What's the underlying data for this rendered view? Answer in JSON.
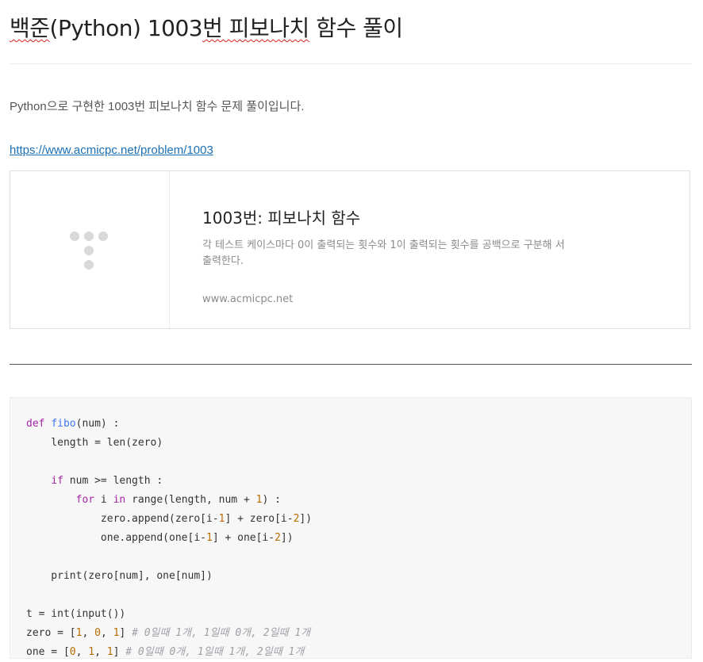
{
  "post": {
    "title_prefix": "백준",
    "title_middle": "(Python) 1003",
    "title_squiggle": "번 피보나치",
    "title_suffix": " 함수 풀이",
    "intro": "Python으로 구현한 1003번 피보나치 함수 문제 풀이입니다.",
    "link_text": "https://www.acmicpc.net/problem/1003"
  },
  "link_card": {
    "title": "1003번: 피보나치 함수",
    "description": "각 테스트 케이스마다 0이 출력되는 횟수와 1이 출력되는 횟수를 공백으로 구분해 서 출력한다.",
    "domain": "www.acmicpc.net"
  },
  "code": {
    "lines": [
      [
        {
          "t": "def",
          "c": "kw"
        },
        {
          "t": " "
        },
        {
          "t": "fibo",
          "c": "fn"
        },
        {
          "t": "(num) :"
        }
      ],
      [
        {
          "t": "    length = len(zero)"
        }
      ],
      [
        {
          "t": ""
        }
      ],
      [
        {
          "t": "    "
        },
        {
          "t": "if",
          "c": "kw"
        },
        {
          "t": " num >= length :"
        }
      ],
      [
        {
          "t": "        "
        },
        {
          "t": "for",
          "c": "kw"
        },
        {
          "t": " i "
        },
        {
          "t": "in",
          "c": "kw"
        },
        {
          "t": " range(length, num + "
        },
        {
          "t": "1",
          "c": "num"
        },
        {
          "t": ") :"
        }
      ],
      [
        {
          "t": "            zero.append(zero[i-"
        },
        {
          "t": "1",
          "c": "num"
        },
        {
          "t": "] + zero[i-"
        },
        {
          "t": "2",
          "c": "num"
        },
        {
          "t": "])"
        }
      ],
      [
        {
          "t": "            one.append(one[i-"
        },
        {
          "t": "1",
          "c": "num"
        },
        {
          "t": "] + one[i-"
        },
        {
          "t": "2",
          "c": "num"
        },
        {
          "t": "])"
        }
      ],
      [
        {
          "t": ""
        }
      ],
      [
        {
          "t": "    print(zero[num], one[num])"
        }
      ],
      [
        {
          "t": ""
        }
      ],
      [
        {
          "t": "t = int(input())"
        }
      ],
      [
        {
          "t": "zero = ["
        },
        {
          "t": "1",
          "c": "num"
        },
        {
          "t": ", "
        },
        {
          "t": "0",
          "c": "num"
        },
        {
          "t": ", "
        },
        {
          "t": "1",
          "c": "num"
        },
        {
          "t": "] "
        },
        {
          "t": "# 0일때 1개, 1일때 0개, 2일때 1개",
          "c": "cm"
        }
      ],
      [
        {
          "t": "one = ["
        },
        {
          "t": "0",
          "c": "num"
        },
        {
          "t": ", "
        },
        {
          "t": "1",
          "c": "num"
        },
        {
          "t": ", "
        },
        {
          "t": "1",
          "c": "num"
        },
        {
          "t": "] "
        },
        {
          "t": "# 0일때 0개, 1일때 1개, 2일때 1개",
          "c": "cm"
        }
      ]
    ]
  }
}
